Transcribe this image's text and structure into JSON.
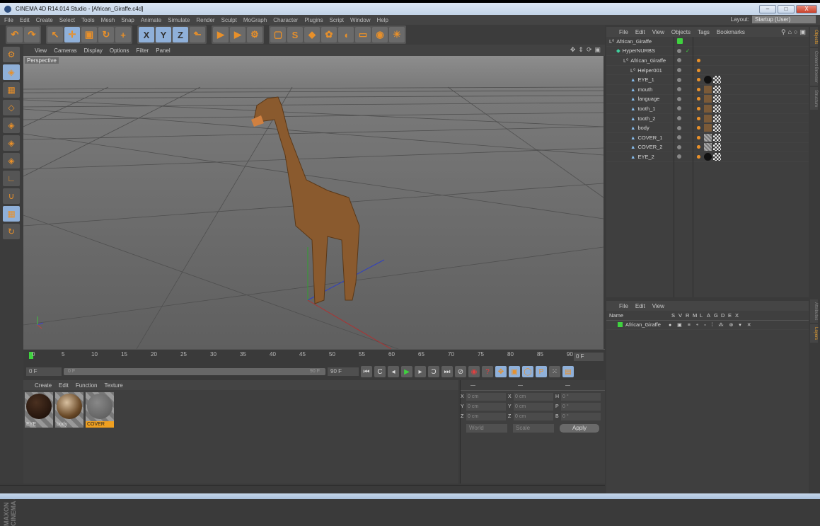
{
  "window": {
    "title": "CINEMA 4D R14.014 Studio - [African_Giraffe.c4d]",
    "min": "–",
    "max": "□",
    "close": "X"
  },
  "menubar": [
    "File",
    "Edit",
    "Create",
    "Select",
    "Tools",
    "Mesh",
    "Snap",
    "Animate",
    "Simulate",
    "Render",
    "Sculpt",
    "MoGraph",
    "Character",
    "Plugins",
    "Script",
    "Window",
    "Help"
  ],
  "layout": {
    "label": "Layout:",
    "value": "Startup (User)"
  },
  "toolbar": {
    "groups": [
      [
        {
          "name": "undo",
          "glyph": "↶"
        },
        {
          "name": "redo",
          "glyph": "↷"
        }
      ],
      [
        {
          "name": "live-selection",
          "glyph": "↖"
        },
        {
          "name": "move",
          "glyph": "✛",
          "sel": true
        },
        {
          "name": "scale",
          "glyph": "▣"
        },
        {
          "name": "rotate",
          "glyph": "↻"
        },
        {
          "name": "last-tool",
          "glyph": "+"
        }
      ],
      [
        {
          "name": "x-axis",
          "glyph": "X",
          "sel": true
        },
        {
          "name": "y-axis",
          "glyph": "Y",
          "sel": true
        },
        {
          "name": "z-axis",
          "glyph": "Z",
          "sel": true
        },
        {
          "name": "coord-system",
          "glyph": "⬑"
        }
      ],
      [
        {
          "name": "render-view",
          "glyph": "▶"
        },
        {
          "name": "render-picture-viewer",
          "glyph": "▶"
        },
        {
          "name": "render-settings",
          "glyph": "⚙"
        }
      ],
      [
        {
          "name": "cube",
          "glyph": "▢"
        },
        {
          "name": "spline",
          "glyph": "S"
        },
        {
          "name": "subdivision",
          "glyph": "◆"
        },
        {
          "name": "cloner",
          "glyph": "✿"
        },
        {
          "name": "deformer",
          "glyph": "◖"
        },
        {
          "name": "floor",
          "glyph": "▭"
        },
        {
          "name": "camera",
          "glyph": "◉"
        },
        {
          "name": "light",
          "glyph": "☀"
        }
      ]
    ]
  },
  "viewport": {
    "menu": [
      "View",
      "Cameras",
      "Display",
      "Options",
      "Filter",
      "Panel"
    ],
    "label": "Perspective"
  },
  "timeline": {
    "ticks": [
      "0",
      "5",
      "10",
      "15",
      "20",
      "25",
      "30",
      "35",
      "40",
      "45",
      "50",
      "55",
      "60",
      "65",
      "70",
      "75",
      "80",
      "85",
      "90"
    ],
    "current_frame": "0 F",
    "start": "0 F",
    "slider_start": "0 F",
    "slider_end": "90 F",
    "end": "90 F"
  },
  "materials": {
    "menu": [
      "Create",
      "Edit",
      "Function",
      "Texture"
    ],
    "items": [
      {
        "name": "EYE",
        "selected": false
      },
      {
        "name": "body",
        "selected": false
      },
      {
        "name": "COVER",
        "selected": true
      }
    ]
  },
  "coordinates": {
    "headers": [
      "—",
      "—",
      "—"
    ],
    "rows": [
      [
        [
          "X",
          "0 cm"
        ],
        [
          "X",
          "0 cm"
        ],
        [
          "H",
          "0 °"
        ]
      ],
      [
        [
          "Y",
          "0 cm"
        ],
        [
          "Y",
          "0 cm"
        ],
        [
          "P",
          "0 °"
        ]
      ],
      [
        [
          "Z",
          "0 cm"
        ],
        [
          "Z",
          "0 cm"
        ],
        [
          "B",
          "0 °"
        ]
      ]
    ],
    "mode1": "World",
    "mode2": "Scale",
    "apply": "Apply"
  },
  "objects": {
    "menu": [
      "File",
      "Edit",
      "View",
      "Objects",
      "Tags",
      "Bookmarks"
    ],
    "items": [
      {
        "name": "African_Giraffe",
        "depth": 0,
        "icon": "null"
      },
      {
        "name": "HyperNURBS",
        "depth": 1,
        "icon": "hypernurbs"
      },
      {
        "name": "African_Giraffe",
        "depth": 2,
        "icon": "null"
      },
      {
        "name": "Helper001",
        "depth": 3,
        "icon": "null"
      },
      {
        "name": "EYE_1",
        "depth": 3,
        "icon": "poly"
      },
      {
        "name": "mouth",
        "depth": 3,
        "icon": "poly"
      },
      {
        "name": "language",
        "depth": 3,
        "icon": "poly"
      },
      {
        "name": "tooth_1",
        "depth": 3,
        "icon": "poly"
      },
      {
        "name": "tooth_2",
        "depth": 3,
        "icon": "poly"
      },
      {
        "name": "body",
        "depth": 3,
        "icon": "poly"
      },
      {
        "name": "COVER_1",
        "depth": 3,
        "icon": "poly"
      },
      {
        "name": "COVER_2",
        "depth": 3,
        "icon": "poly"
      },
      {
        "name": "EYE_2",
        "depth": 3,
        "icon": "poly"
      }
    ]
  },
  "layers": {
    "menu": [
      "File",
      "Edit",
      "View"
    ],
    "columns": [
      "Name",
      "S",
      "V",
      "R",
      "M",
      "L",
      "A",
      "G",
      "D",
      "E",
      "X"
    ],
    "items": [
      {
        "name": "African_Giraffe",
        "color": "#3fd23f"
      }
    ]
  },
  "side_tabs": {
    "top": [
      "Objects",
      "Content Browser",
      "Structure"
    ],
    "bottom": [
      "Attributes",
      "Layers"
    ]
  },
  "brand": "MAXON CINEMA 4D",
  "colors": {
    "accent": "#e8902a",
    "selected": "#8fb0d9",
    "layer_green": "#3fd23f"
  }
}
